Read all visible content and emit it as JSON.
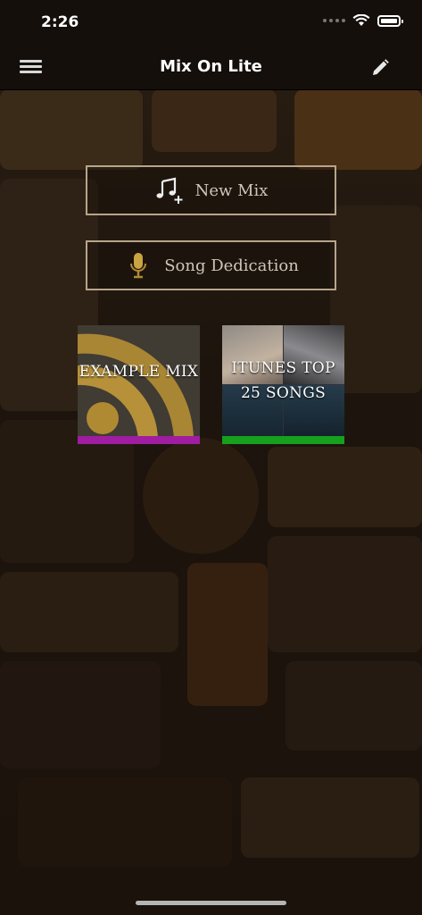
{
  "status_bar": {
    "time": "2:26"
  },
  "nav": {
    "title": "Mix On Lite"
  },
  "actions": {
    "new_mix": "New Mix",
    "song_dedication": "Song Dedication"
  },
  "mixes": [
    {
      "label": "EXAMPLE MIX",
      "bar_color": "#a01ca0",
      "art_icon": "rss-icon"
    },
    {
      "label": "ITUNES TOP 25 SONGS",
      "bar_color": "#179f1e",
      "art_icon": "album-collage"
    }
  ],
  "colors": {
    "bar_bg": "#140f0a",
    "button_border": "#b7a58c",
    "gold": "#b08a32"
  }
}
